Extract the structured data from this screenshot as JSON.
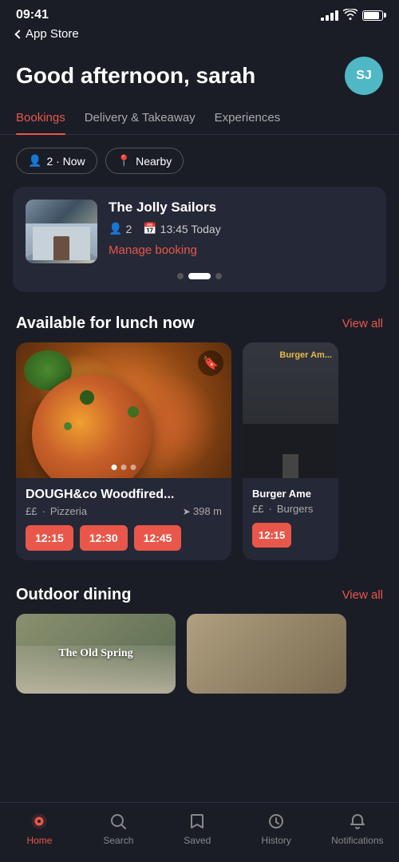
{
  "statusBar": {
    "time": "09:41",
    "backLabel": "App Store"
  },
  "header": {
    "greeting": "Good afternoon, sarah",
    "avatarInitials": "SJ",
    "avatarBg": "#4fb8c4"
  },
  "tabs": [
    {
      "id": "bookings",
      "label": "Bookings",
      "active": true
    },
    {
      "id": "delivery",
      "label": "Delivery & Takeaway",
      "active": false
    },
    {
      "id": "experiences",
      "label": "Experiences",
      "active": false
    }
  ],
  "filters": [
    {
      "id": "guests",
      "icon": "👤",
      "label": "2 · Now"
    },
    {
      "id": "location",
      "icon": "📍",
      "label": "Nearby"
    }
  ],
  "bookingCard": {
    "restaurantName": "The Jolly Sailors",
    "guests": "2",
    "time": "13:45 Today",
    "manageLabel": "Manage booking"
  },
  "lunchSection": {
    "title": "Available for lunch now",
    "viewAllLabel": "View all",
    "restaurants": [
      {
        "id": "dough",
        "name": "DOUGH&co Woodfired...",
        "price": "££",
        "cuisine": "Pizzeria",
        "distance": "398 m",
        "slots": [
          "12:15",
          "12:30",
          "12:45"
        ]
      },
      {
        "id": "burger",
        "name": "Burger Ame",
        "price": "££",
        "cuisine": "Burgers",
        "distance": "",
        "slots": [
          "12:15"
        ]
      }
    ]
  },
  "outdoorSection": {
    "title": "Outdoor dining",
    "viewAllLabel": "View all",
    "venues": [
      {
        "id": "old-spring",
        "name": "The Old Spring"
      },
      {
        "id": "venue2",
        "name": ""
      }
    ]
  },
  "bottomNav": [
    {
      "id": "home",
      "label": "Home",
      "active": true
    },
    {
      "id": "search",
      "label": "Search",
      "active": false
    },
    {
      "id": "saved",
      "label": "Saved",
      "active": false
    },
    {
      "id": "history",
      "label": "History",
      "active": false
    },
    {
      "id": "notifications",
      "label": "Notifications",
      "active": false
    }
  ]
}
